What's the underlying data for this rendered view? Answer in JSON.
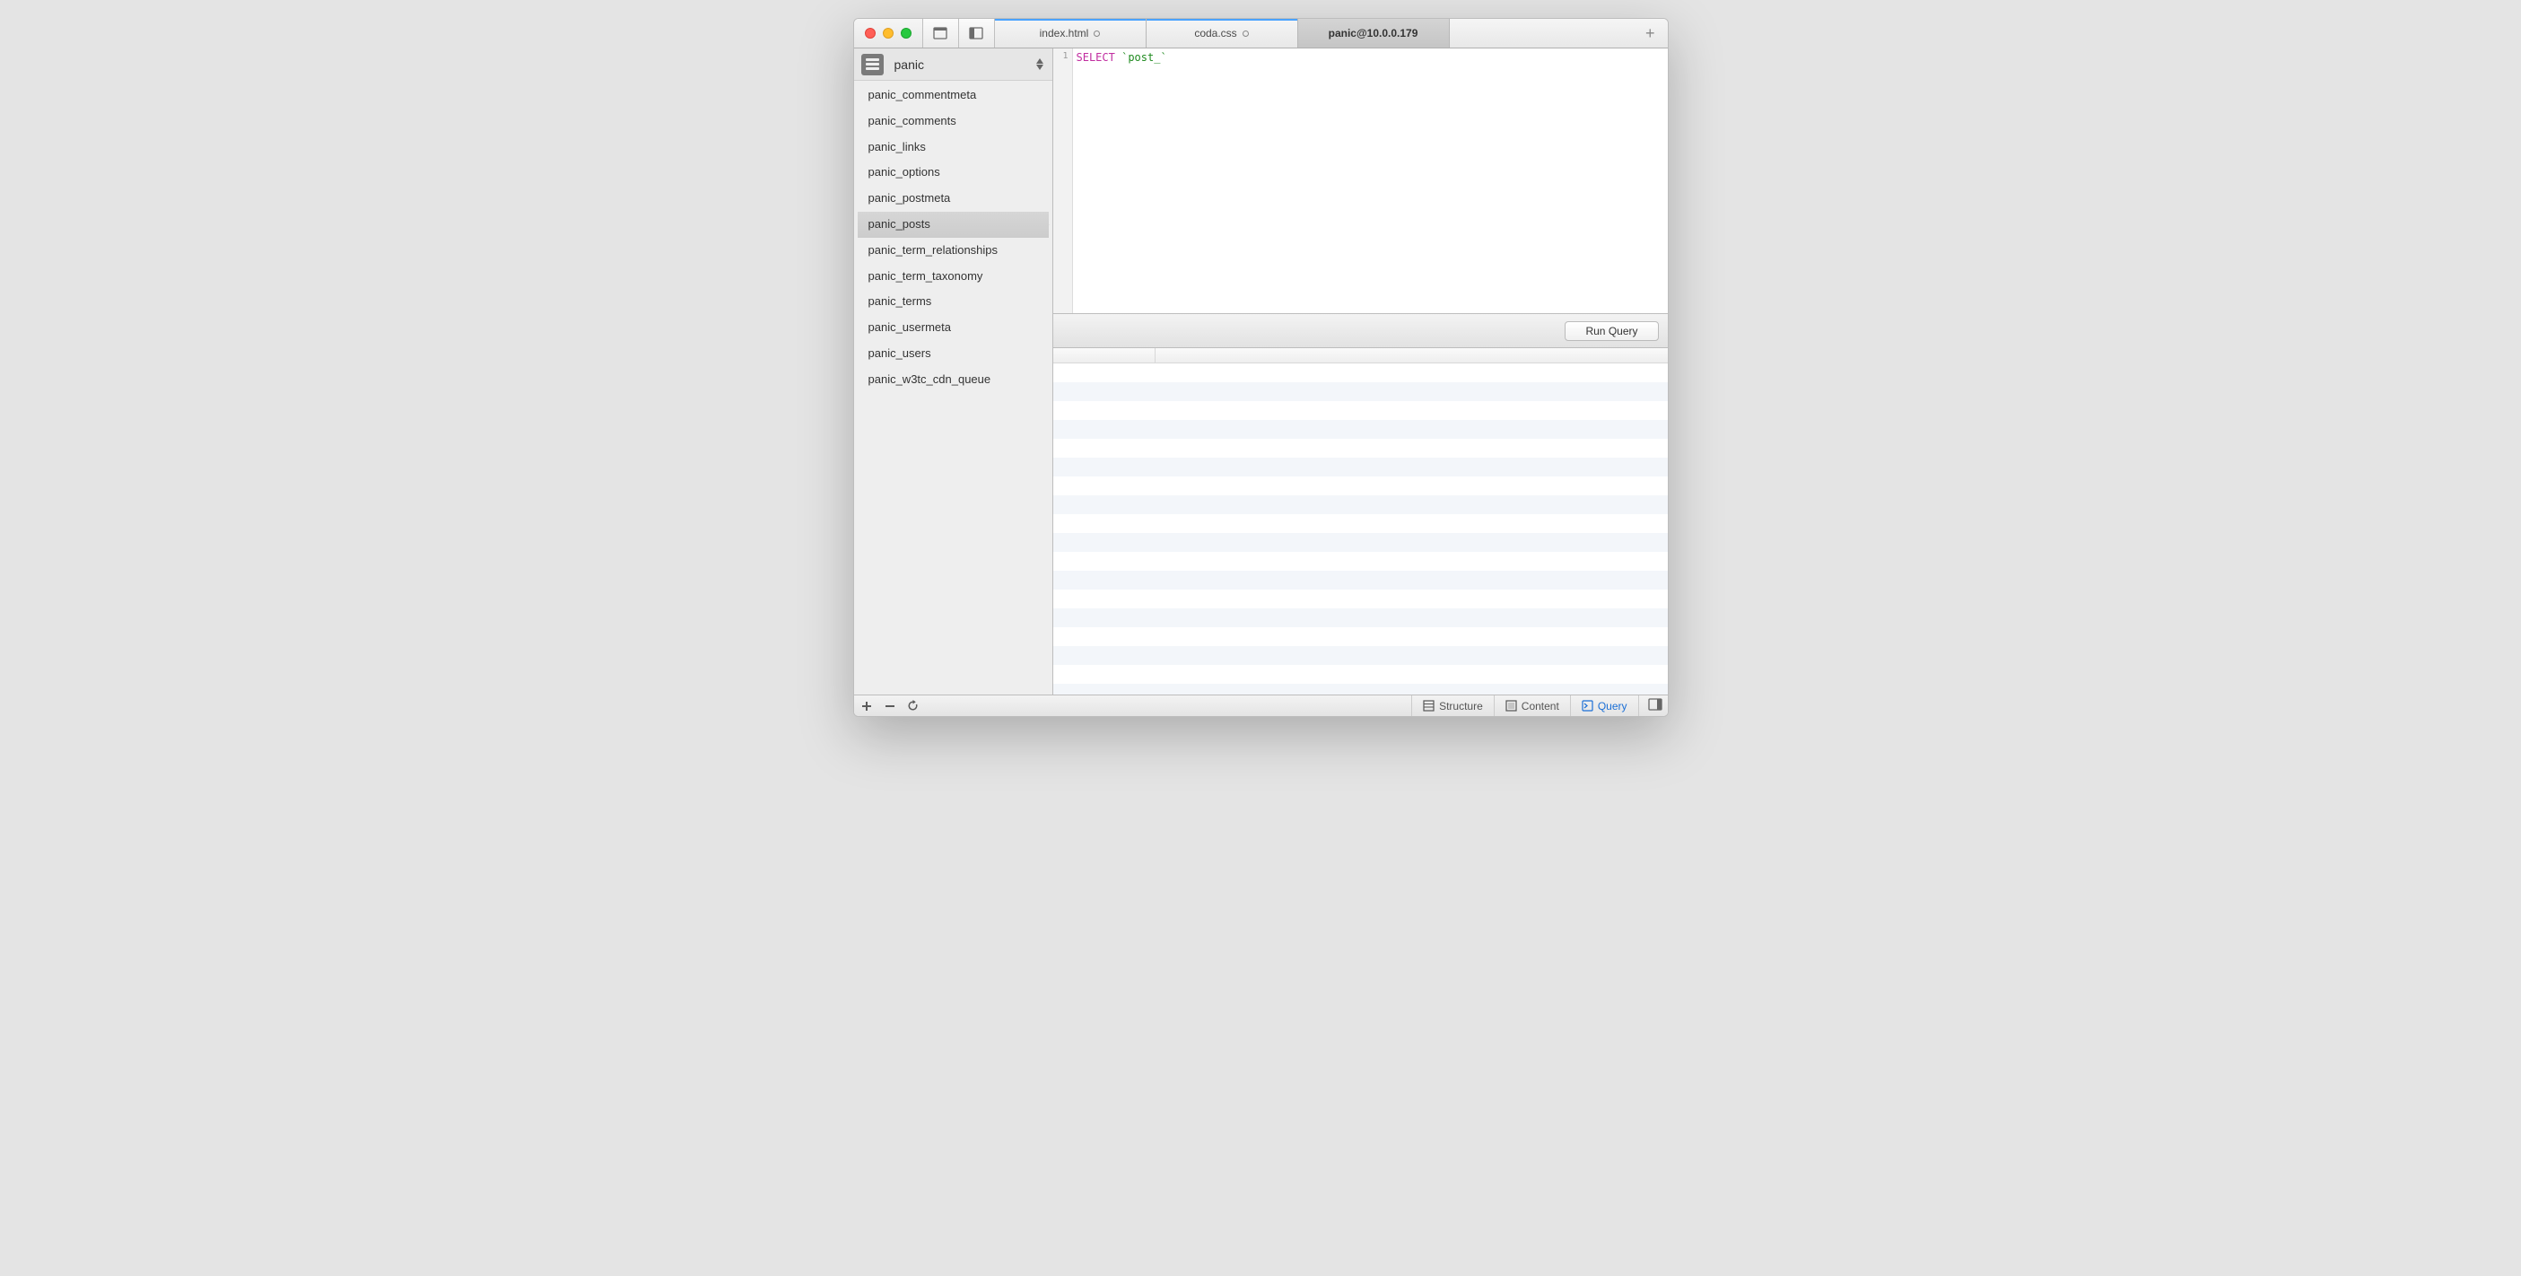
{
  "tabs": [
    {
      "label": "index.html",
      "dirty": true,
      "active": false
    },
    {
      "label": "coda.css",
      "dirty": true,
      "active": false
    },
    {
      "label": "panic@10.0.0.179",
      "dirty": false,
      "active": true
    }
  ],
  "database": {
    "name": "panic",
    "tables": [
      "panic_commentmeta",
      "panic_comments",
      "panic_links",
      "panic_options",
      "panic_postmeta",
      "panic_posts",
      "panic_term_relationships",
      "panic_term_taxonomy",
      "panic_terms",
      "panic_usermeta",
      "panic_users",
      "panic_w3tc_cdn_queue"
    ],
    "selected_index": 5
  },
  "editor": {
    "line_number": "1",
    "tokens": {
      "keyword": "SELECT",
      "string": "`post_`"
    }
  },
  "run_button": "Run Query",
  "bottom": {
    "structure": "Structure",
    "content": "Content",
    "query": "Query"
  },
  "result_row_count": 18
}
